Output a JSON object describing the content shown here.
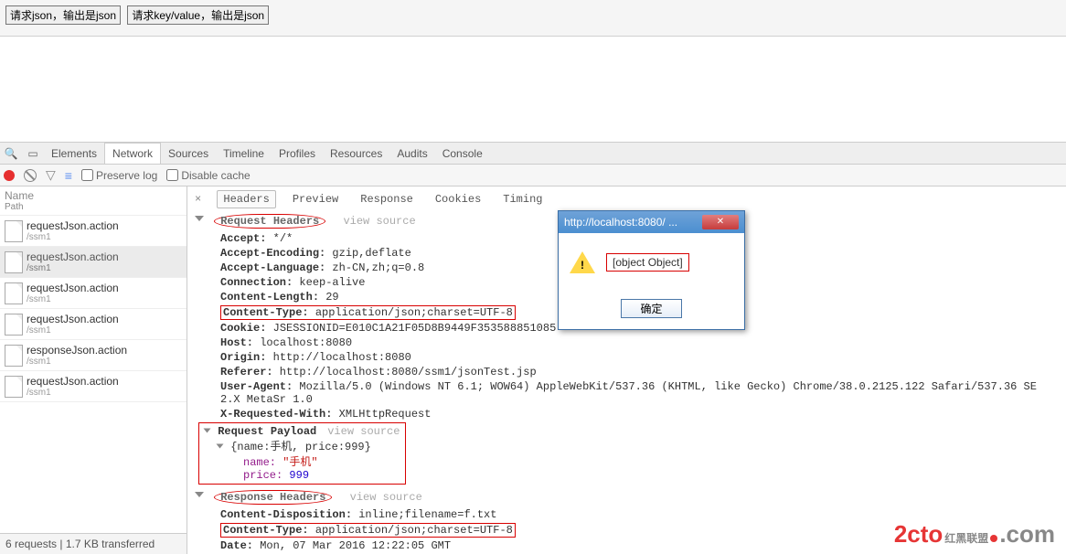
{
  "top": {
    "btn1": "请求json，输出是json",
    "btn2": "请求key/value，输出是json"
  },
  "devtabs": [
    "Elements",
    "Network",
    "Sources",
    "Timeline",
    "Profiles",
    "Resources",
    "Audits",
    "Console"
  ],
  "devtabs_active": 1,
  "toolbar": {
    "preserve": "Preserve log",
    "disable": "Disable cache"
  },
  "leftHead": {
    "name": "Name",
    "path": "Path"
  },
  "requests": [
    {
      "name": "requestJson.action",
      "path": "/ssm1"
    },
    {
      "name": "requestJson.action",
      "path": "/ssm1"
    },
    {
      "name": "requestJson.action",
      "path": "/ssm1"
    },
    {
      "name": "requestJson.action",
      "path": "/ssm1"
    },
    {
      "name": "responseJson.action",
      "path": "/ssm1"
    },
    {
      "name": "requestJson.action",
      "path": "/ssm1"
    }
  ],
  "selectedRequestIndex": 1,
  "leftStatus": "6 requests  |  1.7 KB transferred",
  "subtabs": [
    "Headers",
    "Preview",
    "Response",
    "Cookies",
    "Timing"
  ],
  "subtabs_active": 0,
  "sections": {
    "reqHeaders": "Request Headers",
    "reqPayload": "Request Payload",
    "respHeaders": "Response Headers",
    "viewSource": "view source"
  },
  "reqHeaders": [
    {
      "k": "Accept:",
      "v": " */*"
    },
    {
      "k": "Accept-Encoding:",
      "v": " gzip,deflate"
    },
    {
      "k": "Accept-Language:",
      "v": " zh-CN,zh;q=0.8"
    },
    {
      "k": "Connection:",
      "v": " keep-alive"
    },
    {
      "k": "Content-Length:",
      "v": " 29"
    },
    {
      "k": "Content-Type:",
      "v": " application/json;charset=UTF-8",
      "hl": true
    },
    {
      "k": "Cookie:",
      "v": " JSESSIONID=E010C1A21F05D8B9449F353588851085"
    },
    {
      "k": "Host:",
      "v": " localhost:8080"
    },
    {
      "k": "Origin:",
      "v": " http://localhost:8080"
    },
    {
      "k": "Referer:",
      "v": " http://localhost:8080/ssm1/jsonTest.jsp"
    },
    {
      "k": "User-Agent:",
      "v": " Mozilla/5.0 (Windows NT 6.1; WOW64) AppleWebKit/537.36 (KHTML, like Gecko) Chrome/38.0.2125.122 Safari/537.36 SE 2.X MetaSr 1.0"
    },
    {
      "k": "X-Requested-With:",
      "v": " XMLHttpRequest"
    }
  ],
  "payload": {
    "summary": "{name:手机, price:999}",
    "nameKey": "name: ",
    "nameVal": "\"手机\"",
    "priceKey": "price: ",
    "priceVal": "999"
  },
  "respHeaders": [
    {
      "k": "Content-Disposition:",
      "v": " inline;filename=f.txt"
    },
    {
      "k": "Content-Type:",
      "v": " application/json;charset=UTF-8",
      "hl": true
    },
    {
      "k": "Date:",
      "v": " Mon, 07 Mar 2016 12:22:05 GMT"
    }
  ],
  "dialog": {
    "title": "http://localhost:8080/ ...",
    "msg": "[object Object]",
    "ok": "确定"
  },
  "watermark": {
    "main": "2cto",
    "cn": "红黑联盟",
    "com": ".com"
  }
}
